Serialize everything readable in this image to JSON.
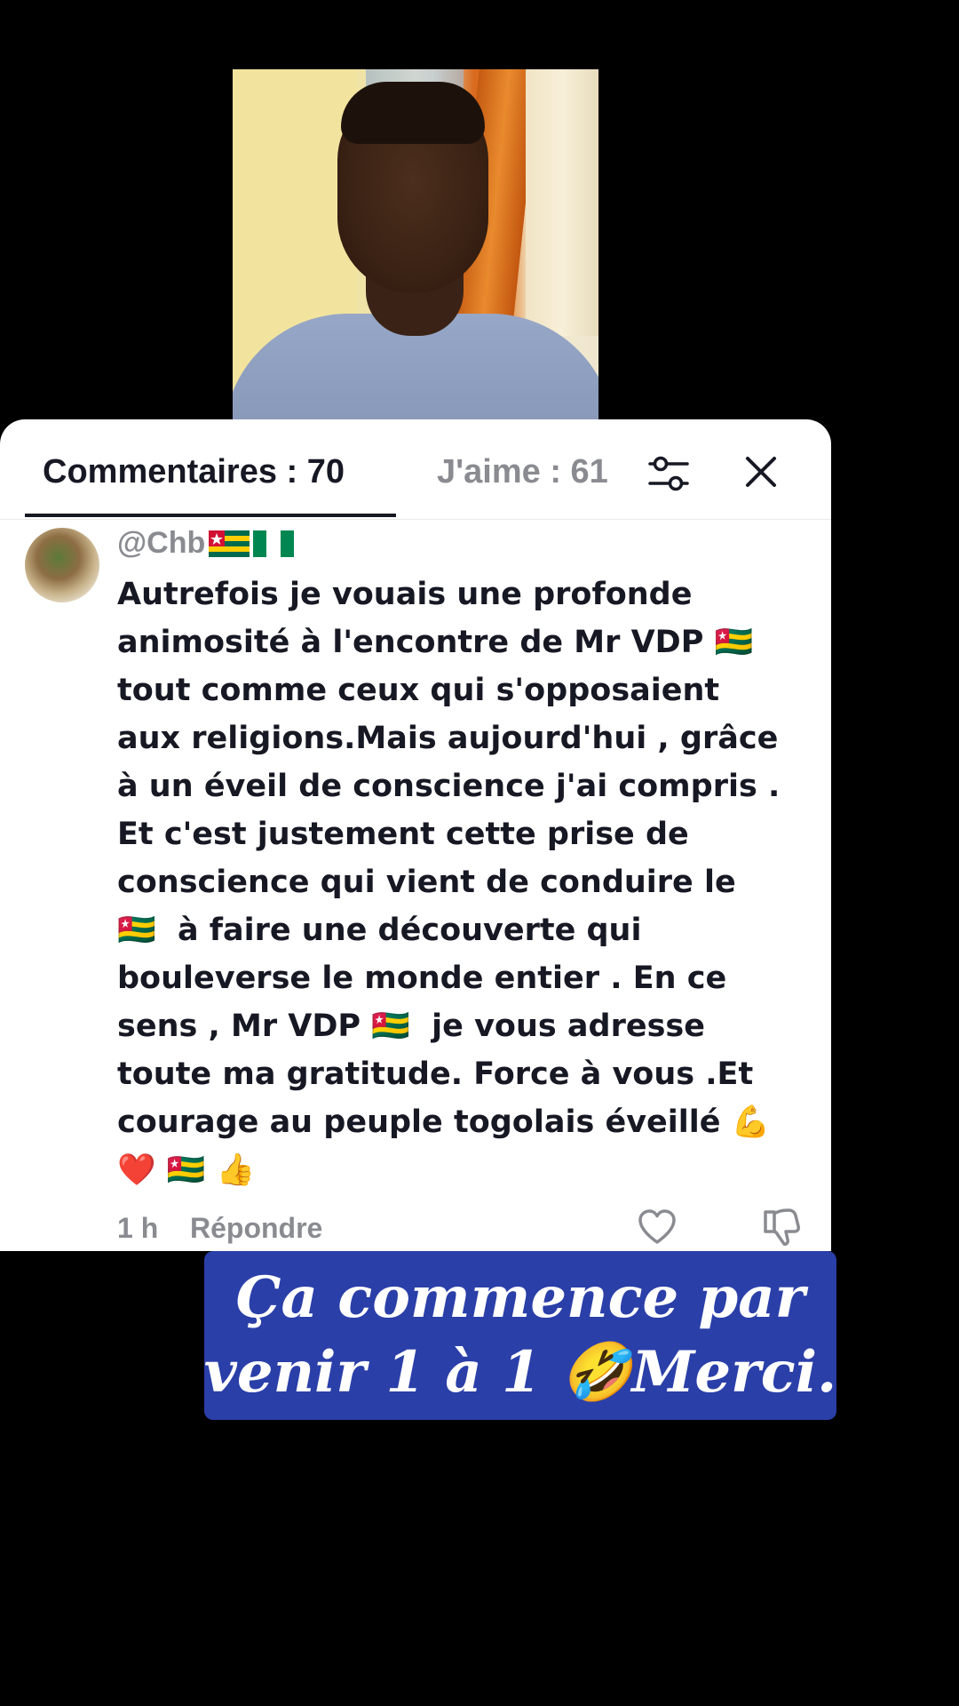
{
  "tabs": {
    "comments_label": "Commentaires : 70",
    "likes_label": "J'aime : 61"
  },
  "icons": {
    "filter": "sliders-icon",
    "close": "close-icon",
    "like": "heart-outline-icon",
    "dislike": "thumbs-down-icon"
  },
  "comment": {
    "username": "@Chb",
    "username_flags": [
      "togo-flag",
      "nigeria-flag"
    ],
    "text": "Autrefois je vouais une profonde\nanimosité à l'encontre de Mr VDP 🇹🇬\ntout comme ceux qui s'opposaient\naux religions.Mais aujourd'hui , grâce\nà un éveil de conscience j'ai compris .\nEt c'est justement cette prise de\nconscience qui vient de conduire le\n🇹🇬  à faire une découverte qui\nbouleverse le monde entier . En ce\nsens , Mr VDP 🇹🇬  je vous adresse\ntoute ma gratitude. Force à vous .Et\ncourage au peuple togolais éveillé 💪\n❤️ 🇹🇬 👍",
    "time": "1 h",
    "reply_label": "Répondre"
  },
  "caption": {
    "line1": "Ça commence par",
    "line2": "venir 1 à 1 🤣Merci."
  },
  "colors": {
    "caption_bg": "#2a3fa8",
    "panel_bg": "#ffffff",
    "text_primary": "#161823",
    "text_secondary": "#8a8b91"
  }
}
